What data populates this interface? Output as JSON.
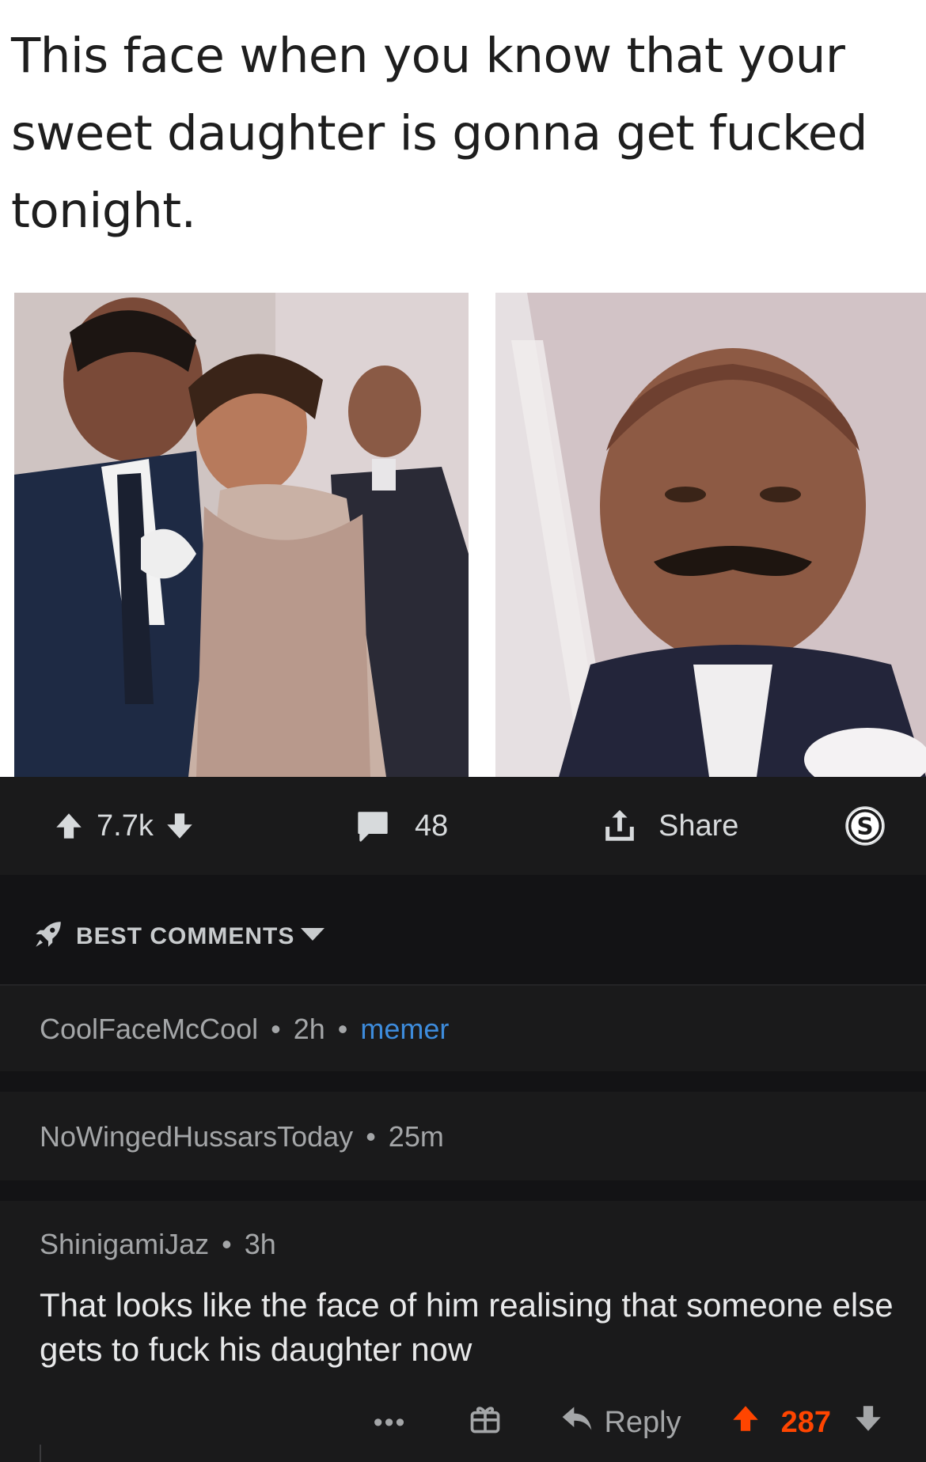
{
  "post": {
    "caption": "This face when you know that your sweet daughter is gonna get fucked tonight.",
    "upvotes": "7.7k",
    "comment_count": "48",
    "share_label": "Share"
  },
  "sort": {
    "label": "BEST COMMENTS"
  },
  "comments": [
    {
      "author": "CoolFaceMcCool",
      "time": "2h",
      "flair": "memer"
    },
    {
      "author": "NoWingedHussarsToday",
      "time": "25m"
    },
    {
      "author": "ShinigamiJaz",
      "time": "3h",
      "body": "That looks like the face of him realising that someone else gets to fuck his daughter now",
      "more": "•••",
      "reply_label": "Reply",
      "score": "287"
    }
  ],
  "colors": {
    "upvote_accent": "#ff4500",
    "flair": "#3d8bdb",
    "background": "#131315",
    "card": "#1a1a1b"
  },
  "icons": [
    "upvote-icon",
    "downvote-icon",
    "comment-icon",
    "share-icon",
    "award-icon",
    "rocket-icon",
    "caret-down-icon",
    "gift-icon",
    "reply-icon"
  ]
}
